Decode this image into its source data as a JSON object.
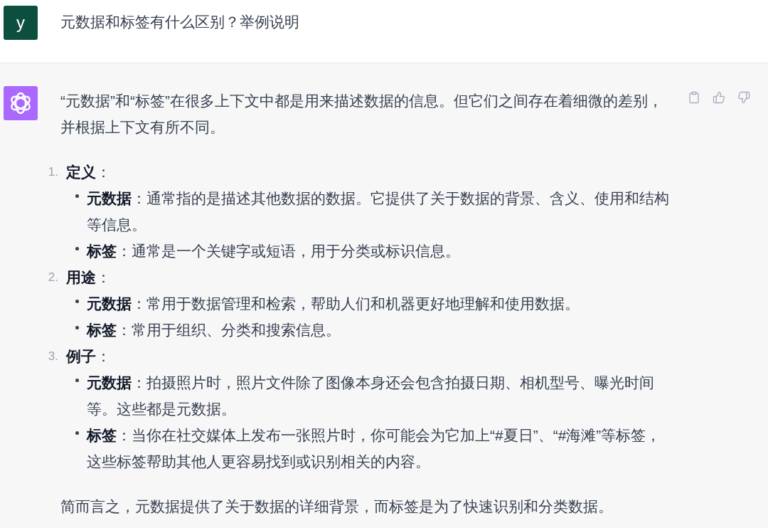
{
  "user_message": {
    "avatar_letter": "y",
    "text": "元数据和标签有什么区别？举例说明"
  },
  "assistant_message": {
    "intro": "“元数据”和“标签”在很多上下文中都是用来描述数据的信息。但它们之间存在着细微的差别，并根据上下文有所不同。",
    "sections": [
      {
        "number": "1.",
        "title": "**定义**：",
        "items": [
          "**元数据**：通常指的是描述其他数据的数据。它提供了关于数据的背景、含义、使用和结构等信息。",
          "**标签**：通常是一个关键字或短语，用于分类或标识信息。"
        ]
      },
      {
        "number": "2.",
        "title": "**用途**：",
        "items": [
          "**元数据**：常用于数据管理和检索，帮助人们和机器更好地理解和使用数据。",
          "**标签**：常用于组织、分类和搜索信息。"
        ]
      },
      {
        "number": "3.",
        "title": "**例子**：",
        "items": [
          "**元数据**：拍摄照片时，照片文件除了图像本身还会包含拍摄日期、相机型号、曝光时间等。这些都是元数据。",
          "**标签**：当你在社交媒体上发布一张照片时，你可能会为它加上“#夏日”、“#海滩”等标签，这些标签帮助其他人更容易找到或识别相关的内容。"
        ]
      }
    ],
    "summary": "简而言之，元数据提供了关于数据的详细背景，而标签是为了快速识别和分类数据。"
  }
}
